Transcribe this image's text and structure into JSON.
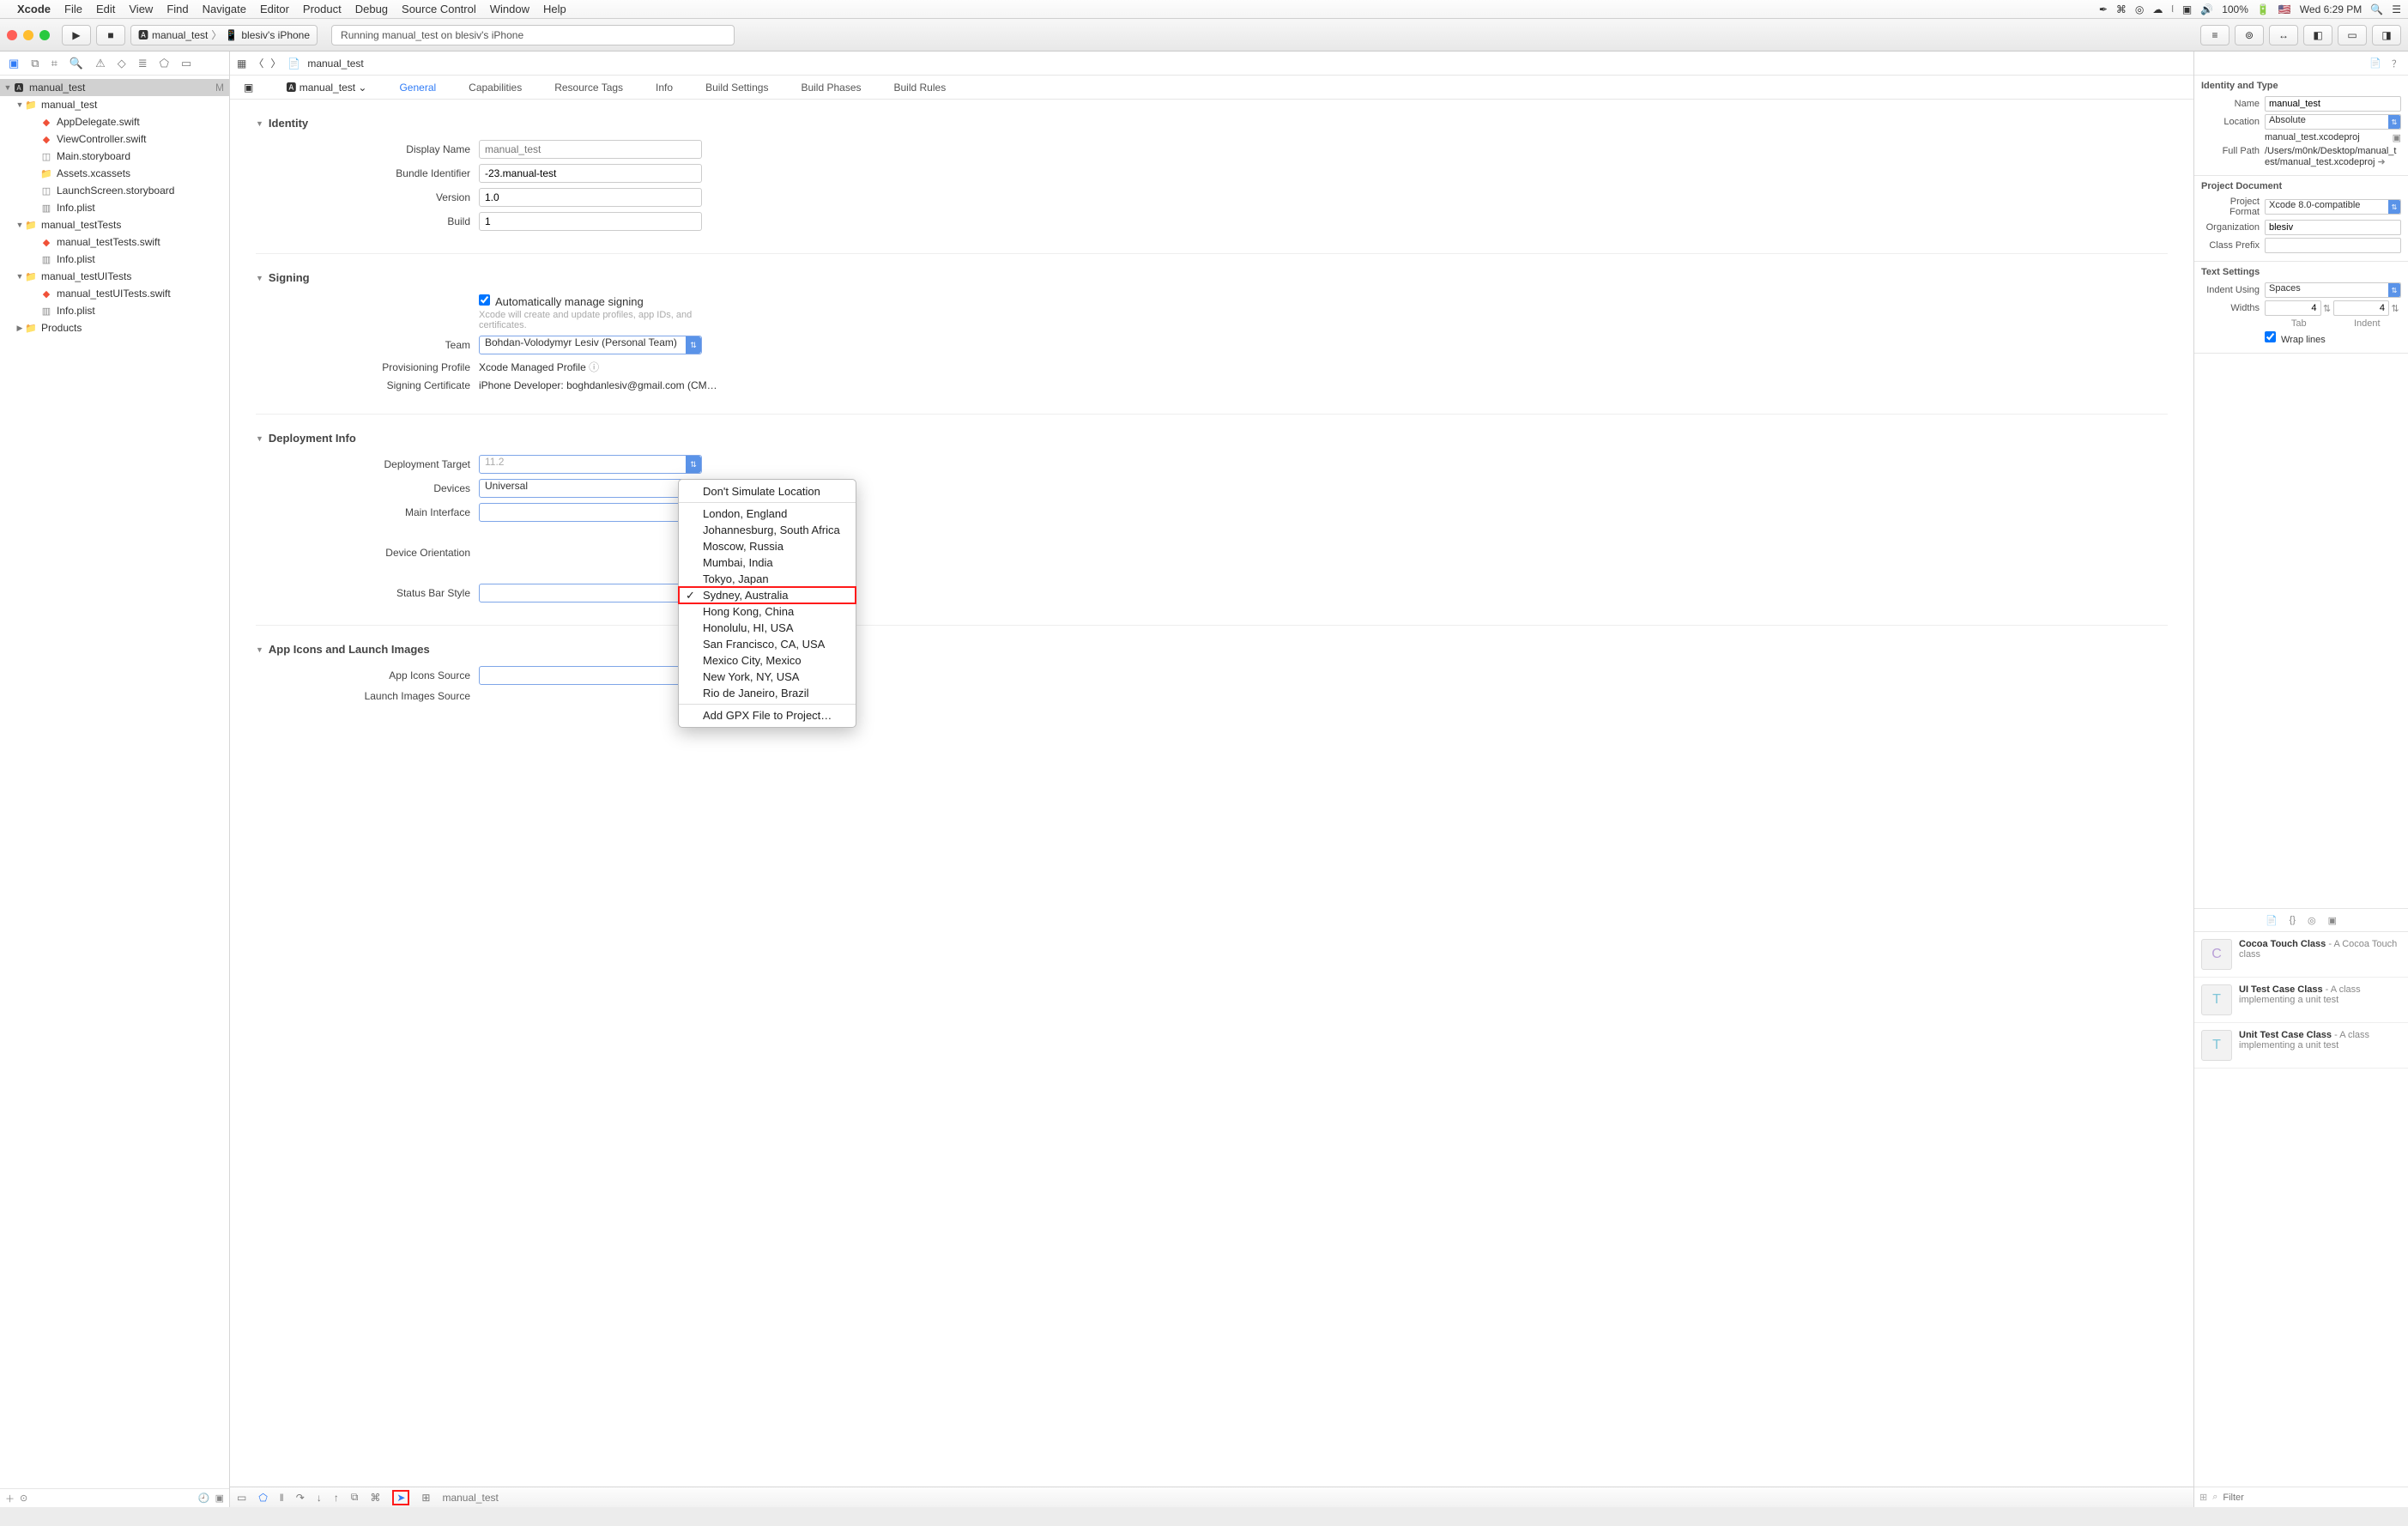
{
  "menubar": {
    "app": "Xcode",
    "items": [
      "File",
      "Edit",
      "View",
      "Find",
      "Navigate",
      "Editor",
      "Product",
      "Debug",
      "Source Control",
      "Window",
      "Help"
    ],
    "battery": "100%",
    "clock": "Wed 6:29 PM"
  },
  "toolbar": {
    "scheme_target": "manual_test",
    "scheme_device": "blesiv's iPhone",
    "status": "Running manual_test on  blesiv's iPhone"
  },
  "navigator": {
    "root": "manual_test",
    "root_badge": "M",
    "groups": [
      {
        "name": "manual_test",
        "children": [
          "AppDelegate.swift",
          "ViewController.swift",
          "Main.storyboard",
          "Assets.xcassets",
          "LaunchScreen.storyboard",
          "Info.plist"
        ]
      },
      {
        "name": "manual_testTests",
        "children": [
          "manual_testTests.swift",
          "Info.plist"
        ]
      },
      {
        "name": "manual_testUITests",
        "children": [
          "manual_testUITests.swift",
          "Info.plist"
        ]
      },
      {
        "name": "Products",
        "children": []
      }
    ]
  },
  "jumpbar": {
    "crumb": "manual_test"
  },
  "tabs": {
    "items": [
      "General",
      "Capabilities",
      "Resource Tags",
      "Info",
      "Build Settings",
      "Build Phases",
      "Build Rules"
    ],
    "target": "manual_test"
  },
  "identity": {
    "title": "Identity",
    "display_name_label": "Display Name",
    "display_name_ph": "manual_test",
    "bundle_label": "Bundle Identifier",
    "bundle_val": "-23.manual-test",
    "version_label": "Version",
    "version_val": "1.0",
    "build_label": "Build",
    "build_val": "1"
  },
  "signing": {
    "title": "Signing",
    "auto_label": "Automatically manage signing",
    "auto_note": "Xcode will create and update profiles, app IDs, and certificates.",
    "team_label": "Team",
    "team_val": "Bohdan-Volodymyr Lesiv (Personal Team)",
    "profile_label": "Provisioning Profile",
    "profile_val": "Xcode Managed Profile",
    "cert_label": "Signing Certificate",
    "cert_val": "iPhone Developer: boghdanlesiv@gmail.com (CM…"
  },
  "deployment": {
    "title": "Deployment Info",
    "target_label": "Deployment Target",
    "target_ph": "11.2",
    "devices_label": "Devices",
    "devices_val": "Universal",
    "main_label": "Main Interface",
    "orient_label": "Device Orientation",
    "status_label": "Status Bar Style"
  },
  "appicons": {
    "title": "App Icons and Launch Images",
    "source_label": "App Icons Source",
    "launch_label": "Launch Images Source"
  },
  "location_menu": {
    "header": "Don't Simulate Location",
    "items": [
      "London, England",
      "Johannesburg, South Africa",
      "Moscow, Russia",
      "Mumbai, India",
      "Tokyo, Japan",
      "Sydney, Australia",
      "Hong Kong, China",
      "Honolulu, HI, USA",
      "San Francisco, CA, USA",
      "Mexico City, Mexico",
      "New York, NY, USA",
      "Rio de Janeiro, Brazil"
    ],
    "selected": "Sydney, Australia",
    "footer": "Add GPX File to Project…"
  },
  "debugbar": {
    "process": "manual_test"
  },
  "inspector": {
    "idtype_title": "Identity and Type",
    "name_label": "Name",
    "name_val": "manual_test",
    "location_label": "Location",
    "location_val": "Absolute",
    "location_path": "manual_test.xcodeproj",
    "fullpath_label": "Full Path",
    "fullpath_val": "/Users/m0nk/Desktop/manual_test/manual_test.xcodeproj",
    "projdoc_title": "Project Document",
    "format_label": "Project Format",
    "format_val": "Xcode 8.0-compatible",
    "org_label": "Organization",
    "org_val": "blesiv",
    "prefix_label": "Class Prefix",
    "prefix_val": "",
    "text_title": "Text Settings",
    "indent_label": "Indent Using",
    "indent_val": "Spaces",
    "widths_label": "Widths",
    "tab_val": "4",
    "indent_w_val": "4",
    "tab_caption": "Tab",
    "indent_caption": "Indent",
    "wrap_label": "Wrap lines",
    "lib": [
      {
        "t": "Cocoa Touch Class",
        "d": "A Cocoa Touch class",
        "c": "C",
        "col": "#b9a0d8"
      },
      {
        "t": "UI Test Case Class",
        "d": "A class implementing a unit test",
        "c": "T",
        "col": "#7fc5d8"
      },
      {
        "t": "Unit Test Case Class",
        "d": "A class implementing a unit test",
        "c": "T",
        "col": "#7fc5d8"
      }
    ],
    "filter_ph": "Filter"
  }
}
